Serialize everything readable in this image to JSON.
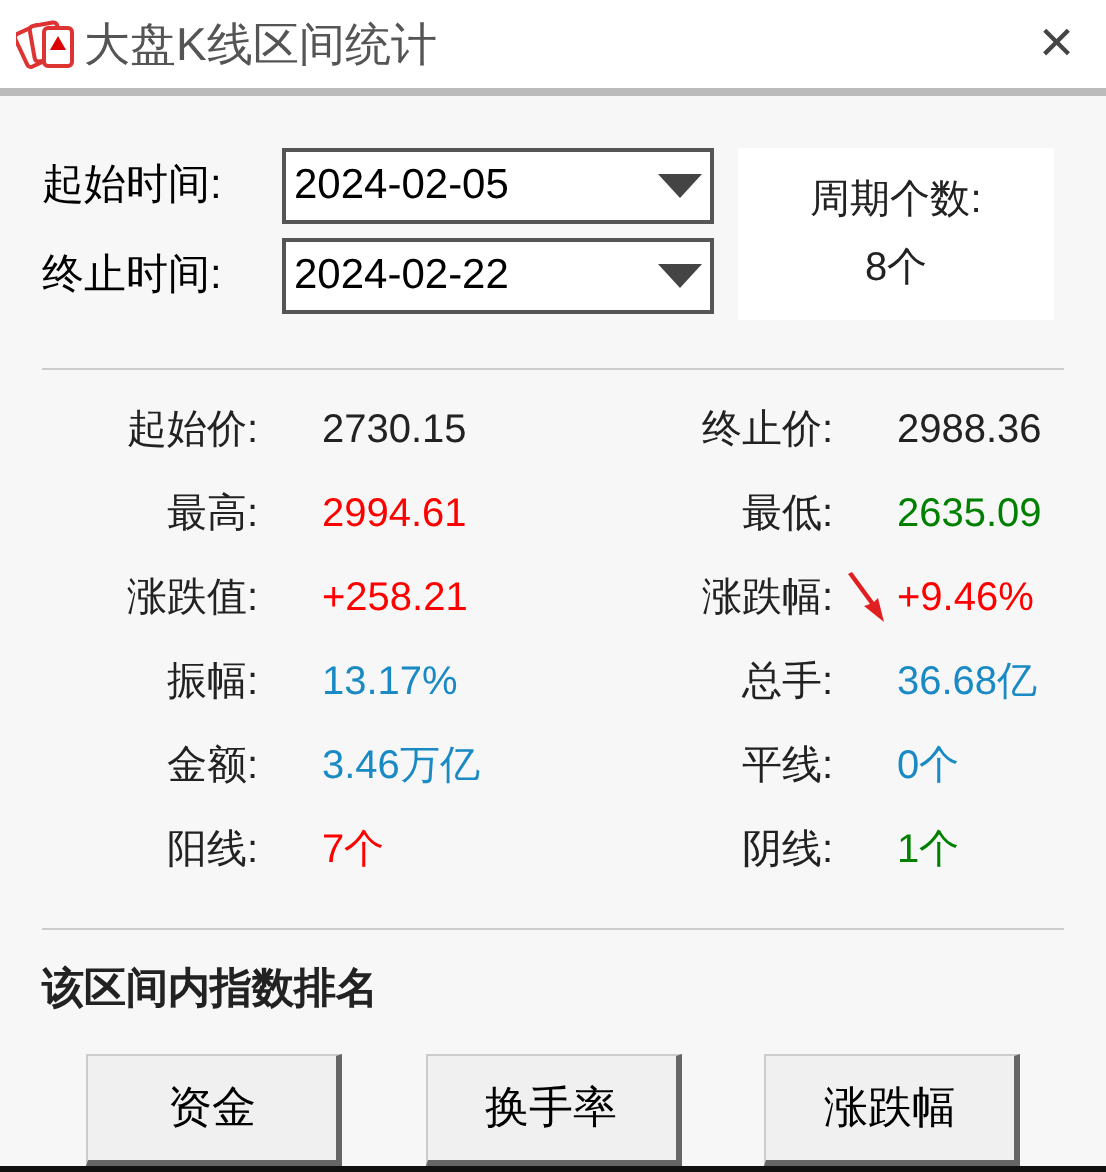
{
  "window": {
    "title": "大盘K线区间统计",
    "close": "×"
  },
  "range": {
    "start_label": "起始时间:",
    "start_value": "2024-02-05",
    "end_label": "终止时间:",
    "end_value": "2024-02-22",
    "period_label": "周期个数:",
    "period_value": "8个"
  },
  "stats": [
    {
      "label": "起始价:",
      "value": "2730.15",
      "color": "#222222"
    },
    {
      "label": "终止价:",
      "value": "2988.36",
      "color": "#222222"
    },
    {
      "label": "最高:",
      "value": "2994.61",
      "color": "#ff0000"
    },
    {
      "label": "最低:",
      "value": "2635.09",
      "color": "#008000"
    },
    {
      "label": "涨跌值:",
      "value": "+258.21",
      "color": "#ff0000"
    },
    {
      "label": "涨跌幅:",
      "value": "+9.46%",
      "color": "#ff0000",
      "arrow": true
    },
    {
      "label": "振幅:",
      "value": "13.17%",
      "color": "#1a8ac4"
    },
    {
      "label": "总手:",
      "value": "36.68亿",
      "color": "#1a8ac4"
    },
    {
      "label": "金额:",
      "value": "3.46万亿",
      "color": "#1a8ac4"
    },
    {
      "label": "平线:",
      "value": "0个",
      "color": "#1a8ac4"
    },
    {
      "label": "阳线:",
      "value": "7个",
      "color": "#ff0000"
    },
    {
      "label": "阴线:",
      "value": "1个",
      "color": "#008000"
    }
  ],
  "ranking": {
    "title": "该区间内指数排名",
    "buttons": [
      "资金",
      "换手率",
      "涨跌幅"
    ]
  }
}
